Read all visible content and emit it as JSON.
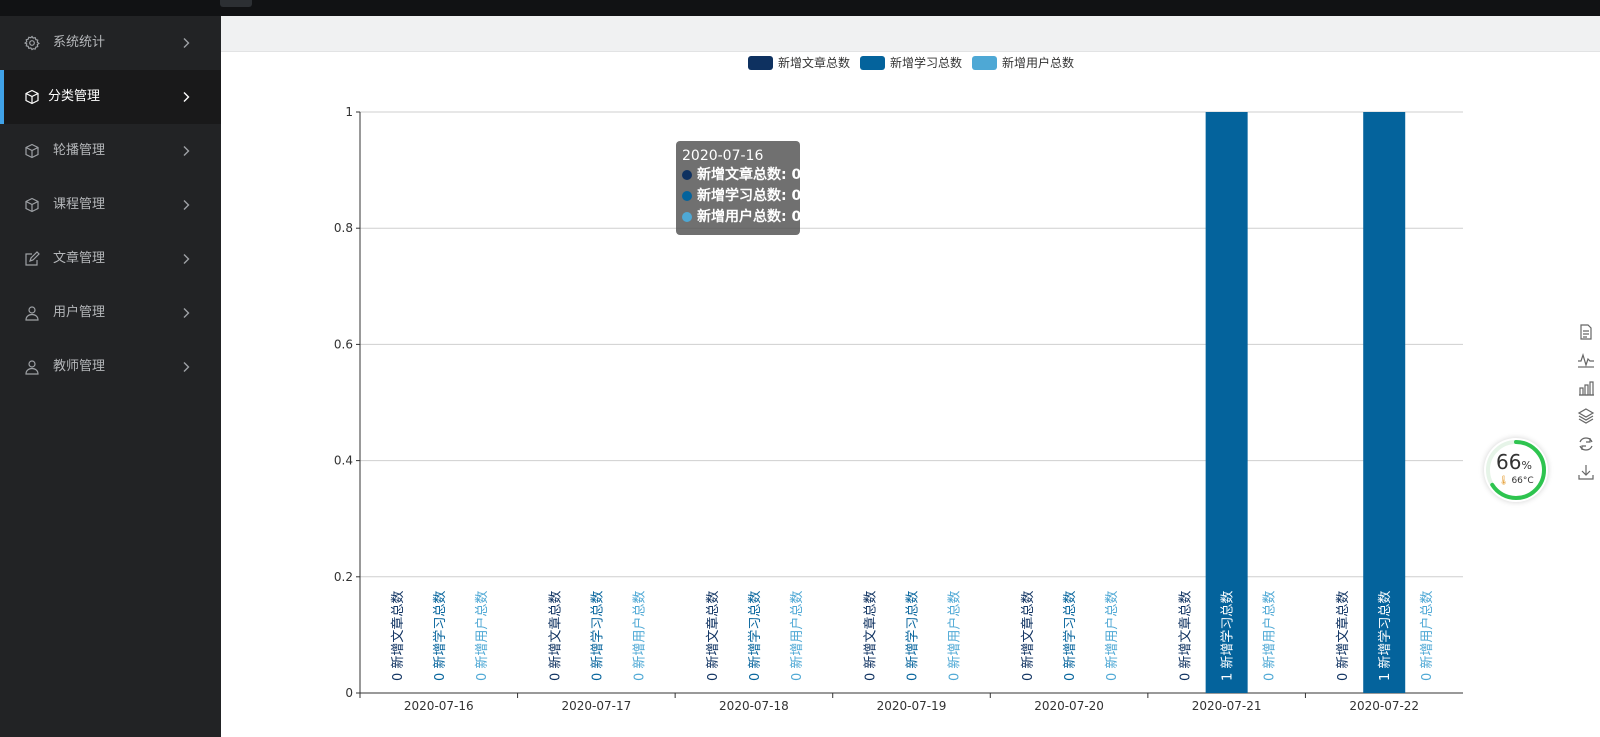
{
  "sidebar": {
    "items": [
      {
        "label": "系统统计",
        "icon": "gear-icon",
        "active": false
      },
      {
        "label": "分类管理",
        "icon": "cube-icon",
        "active": true
      },
      {
        "label": "轮播管理",
        "icon": "cube-icon",
        "active": false
      },
      {
        "label": "课程管理",
        "icon": "cube-icon",
        "active": false
      },
      {
        "label": "文章管理",
        "icon": "edit-icon",
        "active": false
      },
      {
        "label": "用户管理",
        "icon": "user-icon",
        "active": false
      },
      {
        "label": "教师管理",
        "icon": "user-icon",
        "active": false
      }
    ]
  },
  "colors": {
    "sidebar_bg": "#222325",
    "accent": "#40a2e8",
    "series_1": "#0e3160",
    "series_2": "#04639c",
    "series_3": "#4ea8d5"
  },
  "chart_data": {
    "type": "bar",
    "categories": [
      "2020-07-16",
      "2020-07-17",
      "2020-07-18",
      "2020-07-19",
      "2020-07-20",
      "2020-07-21",
      "2020-07-22"
    ],
    "series": [
      {
        "name": "新增文章总数",
        "values": [
          0,
          0,
          0,
          0,
          0,
          0,
          0
        ],
        "color": "#0e3160"
      },
      {
        "name": "新增学习总数",
        "values": [
          0,
          0,
          0,
          0,
          0,
          1,
          1
        ],
        "color": "#04639c"
      },
      {
        "name": "新增用户总数",
        "values": [
          0,
          0,
          0,
          0,
          0,
          0,
          0
        ],
        "color": "#4ea8d5"
      }
    ],
    "ylim": [
      0,
      1
    ],
    "yticks": [
      "0",
      "0.2",
      "0.4",
      "0.6",
      "0.8",
      "1"
    ],
    "grid": true,
    "legend": "top-center",
    "data_labels": "rotated series name + value inside each bar"
  },
  "tooltip": {
    "title": "2020-07-16",
    "rows": [
      {
        "label": "新增文章总数: 0",
        "color": "#0e3160"
      },
      {
        "label": "新增学习总数: 0",
        "color": "#04639c"
      },
      {
        "label": "新增用户总数: 0",
        "color": "#4ea8d5"
      }
    ]
  },
  "toolbox": {
    "tools": [
      "data-view-icon",
      "line-chart-icon",
      "bar-chart-icon",
      "stack-icon",
      "refresh-icon",
      "download-icon"
    ]
  },
  "widget": {
    "value": "66",
    "unit": "%",
    "temp": "66°C",
    "fraction": 0.66
  }
}
